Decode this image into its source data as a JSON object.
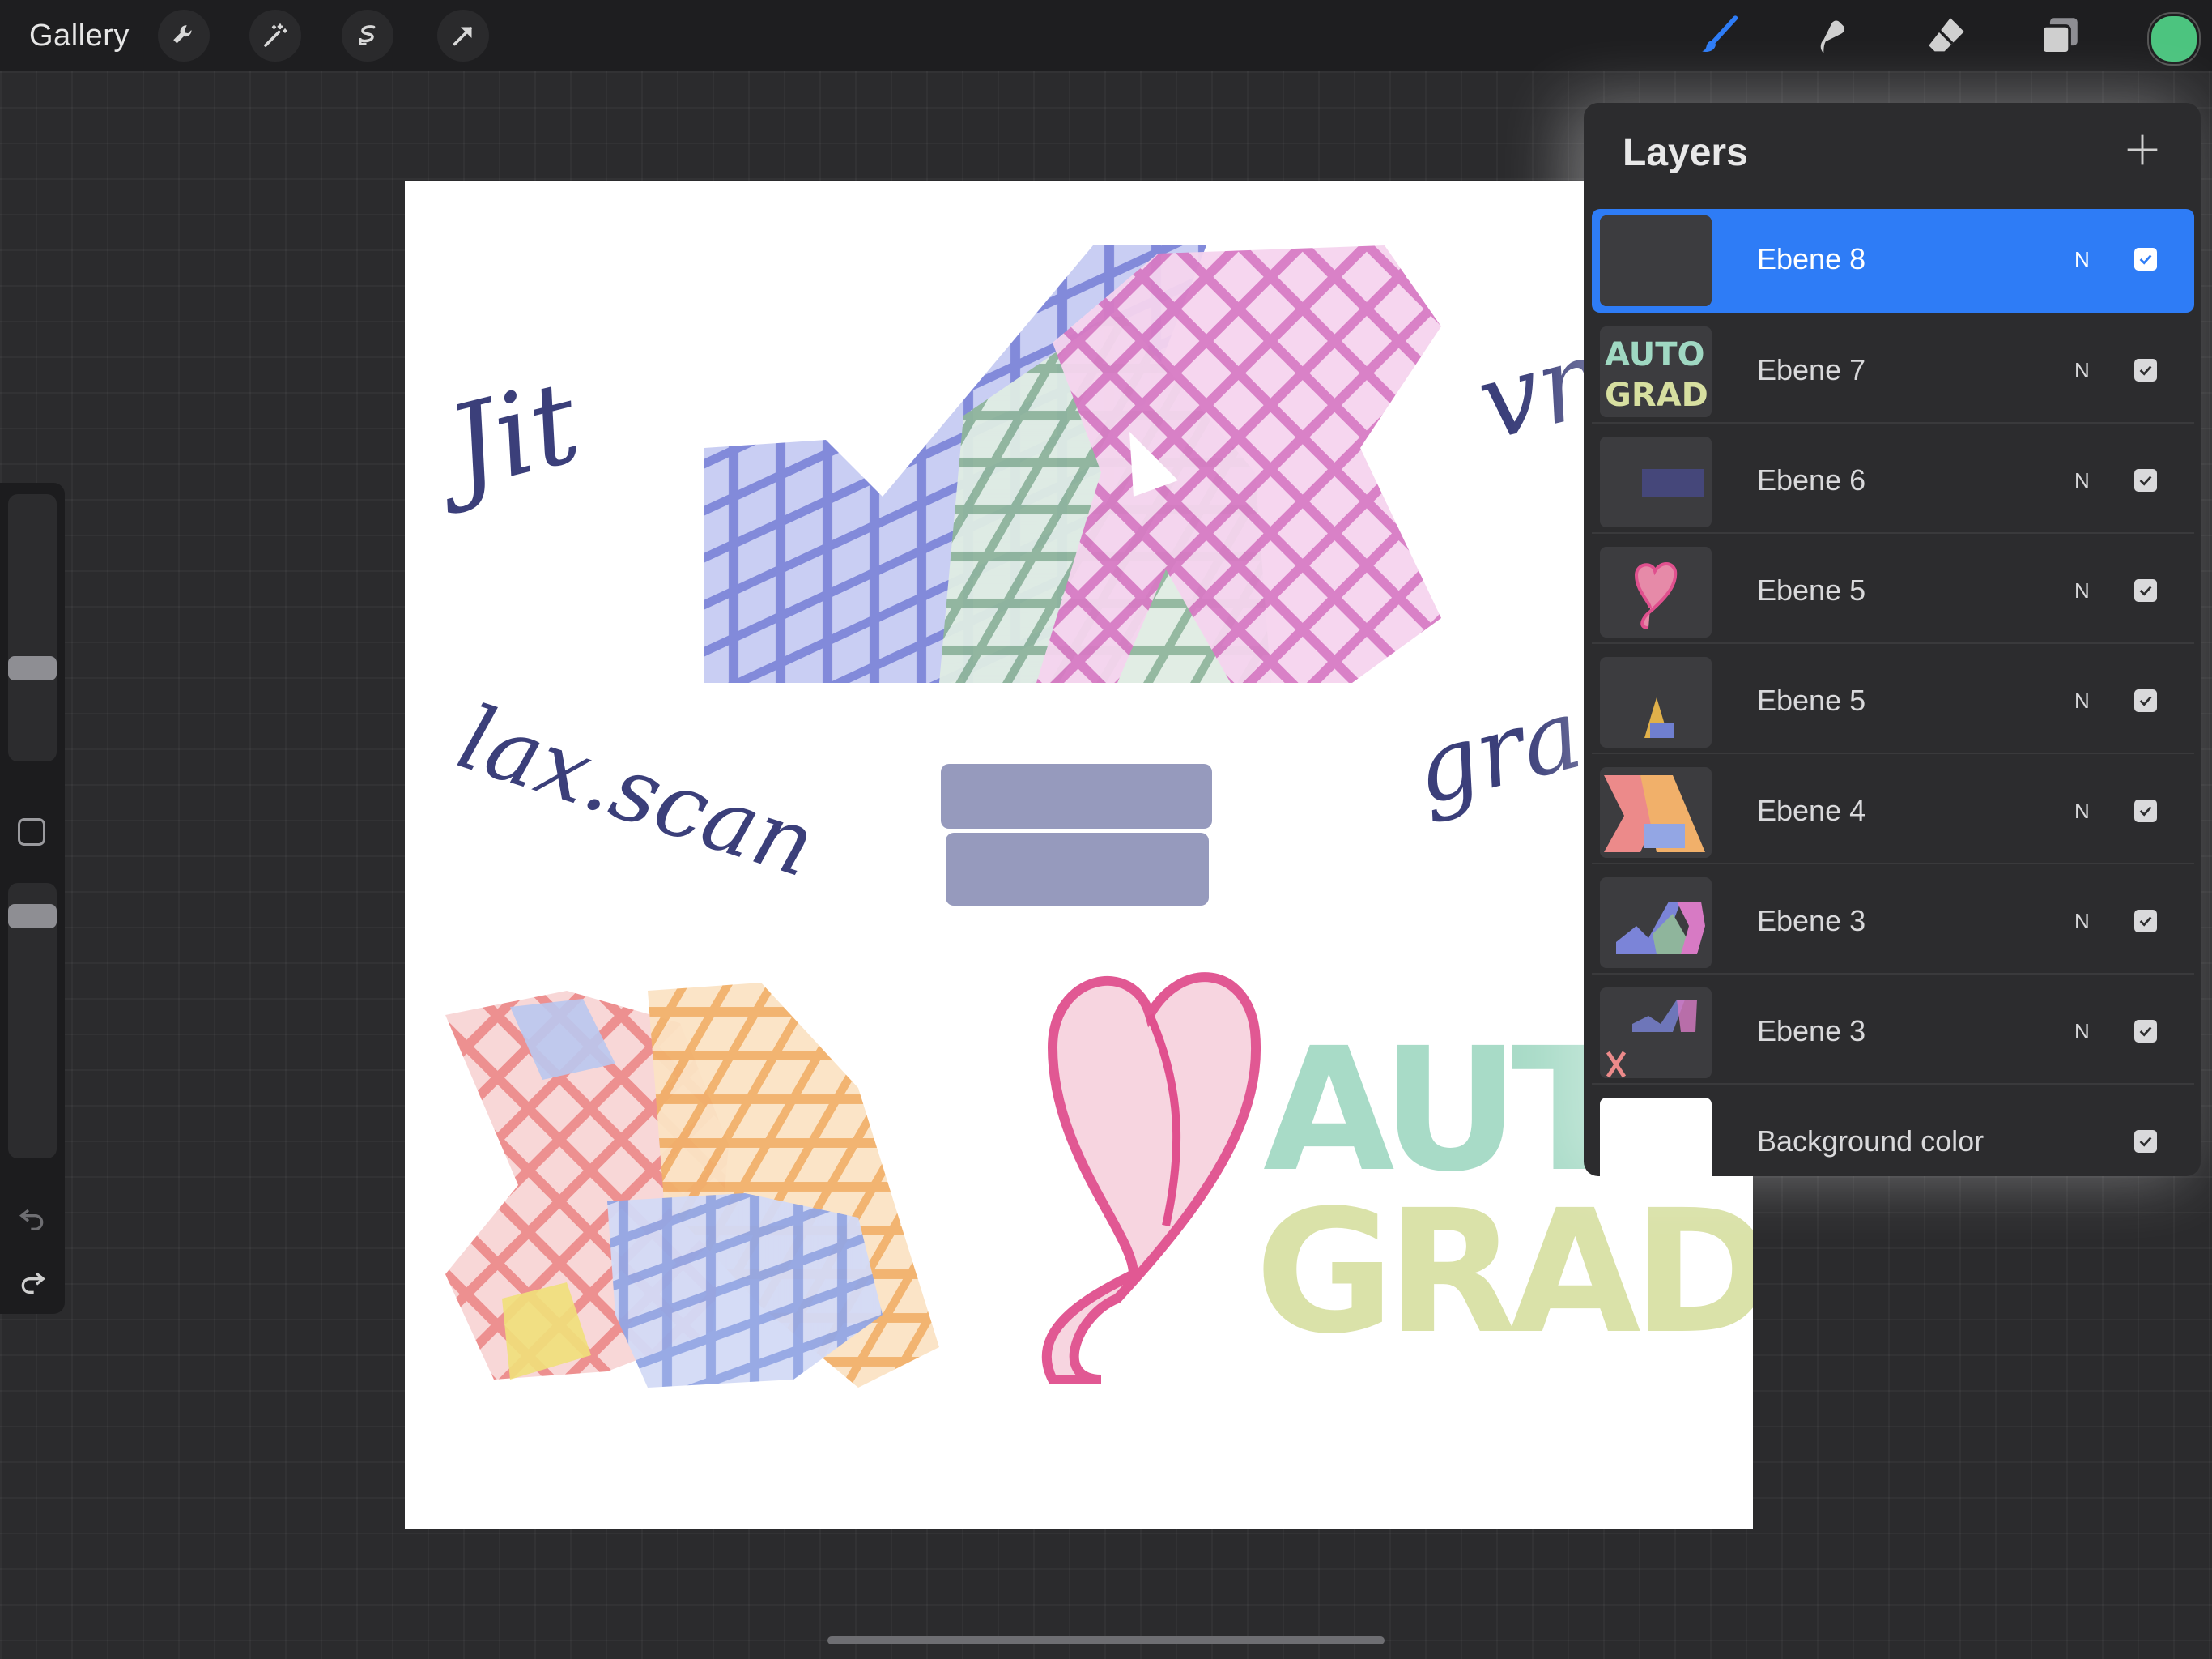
{
  "topbar": {
    "gallery_label": "Gallery",
    "left_tools": [
      {
        "name": "wrench-icon"
      },
      {
        "name": "magic-wand-icon"
      },
      {
        "name": "selection-icon"
      },
      {
        "name": "transform-arrow-icon"
      }
    ],
    "right_tools": [
      {
        "name": "brush-icon",
        "active": true
      },
      {
        "name": "smudge-icon"
      },
      {
        "name": "eraser-icon"
      },
      {
        "name": "layers-icon"
      }
    ],
    "current_color": "#4cc47f"
  },
  "canvas": {
    "texts": [
      "Jit",
      "vm",
      "lax.scan",
      "gra"
    ],
    "words": [
      "AUTO",
      "GRAD"
    ]
  },
  "layers_panel": {
    "title": "Layers",
    "add_icon": "plus-icon",
    "layers": [
      {
        "name": "Ebene 8",
        "blend": "N",
        "visible": true,
        "active": true,
        "thumb": "blank"
      },
      {
        "name": "Ebene 7",
        "blend": "N",
        "visible": true,
        "active": false,
        "thumb": "autograd"
      },
      {
        "name": "Ebene 6",
        "blend": "N",
        "visible": true,
        "active": false,
        "thumb": "stroke"
      },
      {
        "name": "Ebene 5",
        "blend": "N",
        "visible": true,
        "active": false,
        "thumb": "heart"
      },
      {
        "name": "Ebene 5",
        "blend": "N",
        "visible": true,
        "active": false,
        "thumb": "small-a"
      },
      {
        "name": "Ebene 4",
        "blend": "N",
        "visible": true,
        "active": false,
        "thumb": "xa-color"
      },
      {
        "name": "Ebene 3",
        "blend": "N",
        "visible": true,
        "active": false,
        "thumb": "xa-top"
      },
      {
        "name": "Ebene 3",
        "blend": "N",
        "visible": true,
        "active": false,
        "thumb": "xa-small"
      }
    ],
    "background": {
      "name": "Background color",
      "visible": true,
      "color": "#ffffff"
    }
  },
  "colors": {
    "accent": "#2e7cf6",
    "blue_blocks": "#7b84d8",
    "green_blocks": "#8fb59c",
    "pink_blocks": "#d77ac4",
    "ink": "#3b3f7a"
  }
}
